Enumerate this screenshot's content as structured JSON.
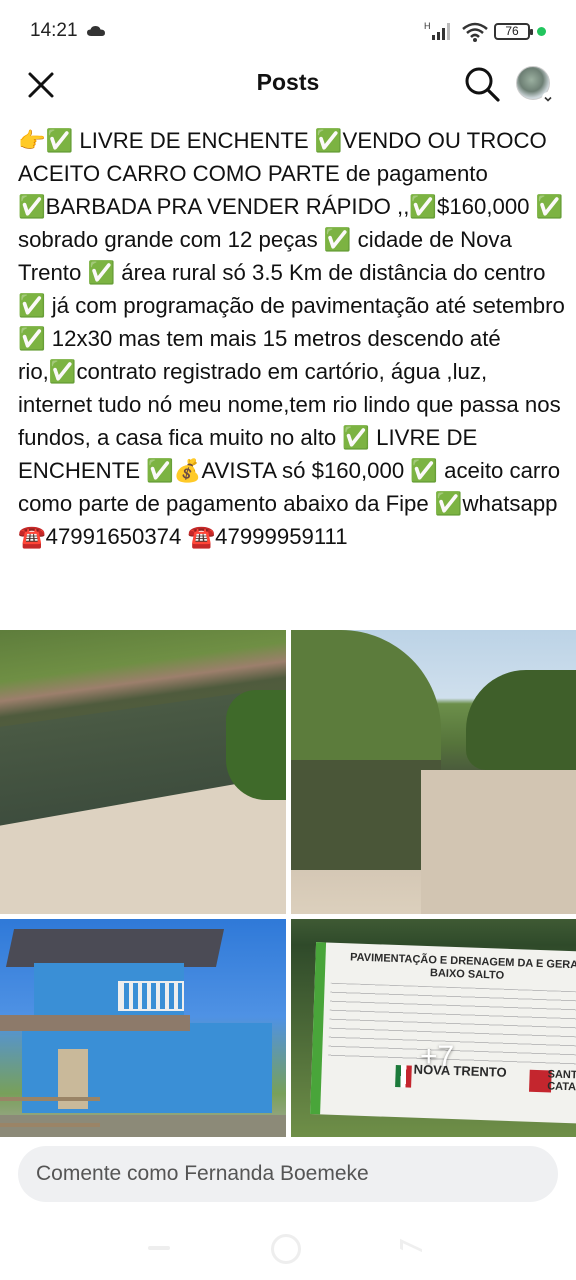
{
  "status_bar": {
    "time": "14:21",
    "battery": "76",
    "icons": [
      "cloud-icon",
      "signal-icon",
      "wifi-icon",
      "battery-icon",
      "charging-dot-icon"
    ]
  },
  "header": {
    "title": "Posts",
    "close_icon": "close-icon",
    "search_icon": "search-icon",
    "avatar_icon": "avatar"
  },
  "post": {
    "text": "👉✅ LIVRE DE ENCHENTE ✅VENDO OU TROCO ACEITO CARRO COMO PARTE de pagamento ✅BARBADA PRA VENDER RÁPIDO ,,✅$160,000 ✅ sobrado grande com 12 peças ✅ cidade de Nova Trento ✅ área rural só 3.5 Km de distância do centro ✅ já com programação de pavimentação até setembro ✅ 12x30 mas tem mais 15 metros descendo até rio,✅contrato registrado em cartório, água ,luz, internet tudo nó meu nome,tem rio lindo que passa nos fundos, a casa fica muito no alto ✅ LIVRE DE ENCHENTE ✅💰AVISTA só $160,000 ✅ aceito carro como parte de pagamento abaixo da Fipe ✅whatsapp ☎️47991650374 ☎️47999959111",
    "photos": [
      {
        "name": "photo-river-1"
      },
      {
        "name": "photo-river-2"
      },
      {
        "name": "photo-house"
      },
      {
        "name": "photo-sign"
      }
    ],
    "more_photos": "+7",
    "sign": {
      "title": "PAVIMENTAÇÃO E DRENAGEM DA E GERAL BAIXO SALTO",
      "logo_left": "NOVA TRENTO",
      "logo_right": "SANT CATA"
    }
  },
  "comment": {
    "placeholder": "Comente como Fernanda Boemeke"
  },
  "nav": {
    "icons": [
      "recents-icon",
      "home-icon",
      "back-icon"
    ]
  }
}
